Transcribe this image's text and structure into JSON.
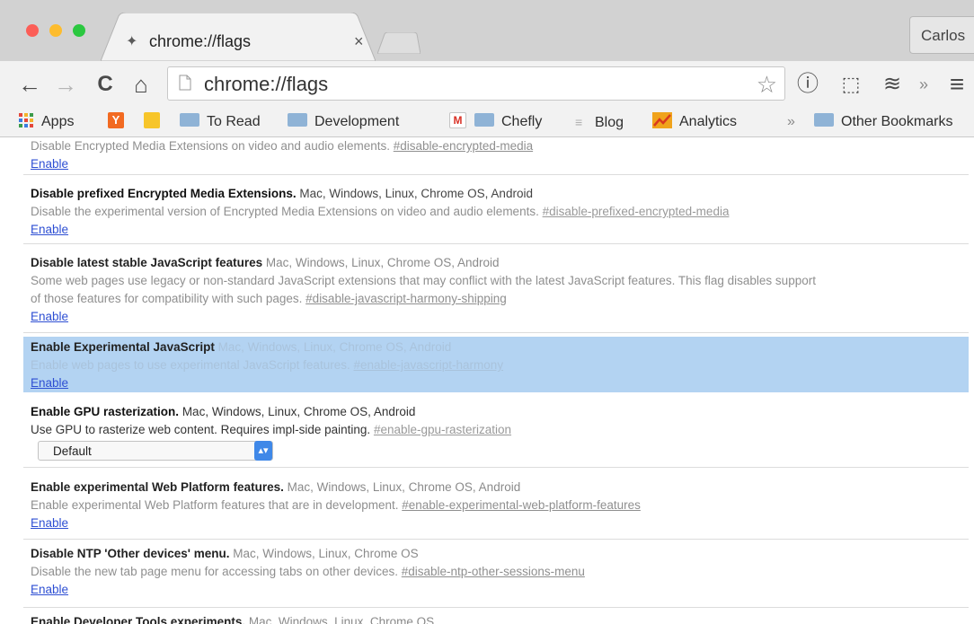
{
  "tab": {
    "favicon": "flags-icon",
    "title": "chrome://flags",
    "close": "×"
  },
  "profile": "Carlos",
  "toolbar": {
    "back": "←",
    "forward": "→",
    "reload": "C",
    "home": "⌂",
    "url": "chrome://flags",
    "star": "☆",
    "extension_1": "ⓘ",
    "extension_2": "⬚",
    "extension_3": "≋",
    "overflow": "»",
    "menu": "≡"
  },
  "bookmarks": [
    {
      "label": "Apps",
      "icon": "apps-grid-icon"
    },
    {
      "label": "Y",
      "icon": "y-icon"
    },
    {
      "label": "",
      "icon": "keep-icon"
    },
    {
      "label": "To Read",
      "icon": "folder-icon"
    },
    {
      "label": "Development",
      "icon": "folder-icon"
    },
    {
      "label": "M",
      "icon": "gmail-icon"
    },
    {
      "label": "Chefly",
      "icon": "folder-icon"
    },
    {
      "label": "Blog",
      "icon": "doc-icon"
    },
    {
      "label": "Analytics",
      "icon": "analytics-icon"
    },
    {
      "label": "»",
      "icon": "chevron-icon"
    },
    {
      "label": "Other Bookmarks",
      "icon": "folder-icon"
    }
  ],
  "flags": [
    {
      "name": "",
      "platforms": "",
      "description": "Disable Encrypted Media Extensions on video and audio elements.",
      "description2": "",
      "anchor": "#disable-encrypted-media",
      "action": "Enable"
    },
    {
      "name": "Disable prefixed Encrypted Media Extensions.",
      "platforms": "Mac, Windows, Linux, Chrome OS, Android",
      "description": "Disable the experimental version of Encrypted Media Extensions on video and audio elements.",
      "description2": "",
      "anchor": "#disable-prefixed-encrypted-media",
      "action": "Enable"
    },
    {
      "name": "Disable latest stable JavaScript features",
      "platforms": "Mac, Windows, Linux, Chrome OS, Android",
      "description": "Some web pages use legacy or non-standard JavaScript extensions that may conflict with the latest JavaScript features. This flag disables support",
      "description2": "of those features for compatibility with such pages.",
      "anchor": "#disable-javascript-harmony-shipping",
      "action": "Enable"
    },
    {
      "name": "Enable Experimental JavaScript",
      "platforms": "Mac, Windows, Linux, Chrome OS, Android",
      "description": "Enable web pages to use experimental JavaScript features.",
      "description2": "",
      "anchor": "#enable-javascript-harmony",
      "action": "Enable"
    },
    {
      "name": "Enable GPU rasterization.",
      "platforms": "Mac, Windows, Linux, Chrome OS, Android",
      "description": "Use GPU to rasterize web content. Requires impl-side painting.",
      "description2": "",
      "anchor": "#enable-gpu-rasterization",
      "select_value": "Default"
    },
    {
      "name": "Enable experimental Web Platform features.",
      "platforms": "Mac, Windows, Linux, Chrome OS, Android",
      "description": "Enable experimental Web Platform features that are in development.",
      "description2": "",
      "anchor": "#enable-experimental-web-platform-features",
      "action": "Enable"
    },
    {
      "name": "Disable NTP 'Other devices' menu.",
      "platforms": "Mac, Windows, Linux, Chrome OS",
      "description": "Disable the new tab page menu for accessing tabs on other devices.",
      "description2": "",
      "anchor": "#disable-ntp-other-sessions-menu",
      "action": "Enable"
    },
    {
      "name": "Enable Developer Tools experiments.",
      "platforms": "Mac, Windows, Linux, Chrome OS",
      "description": "",
      "description2": "",
      "anchor": "",
      "action": ""
    }
  ],
  "colors": {
    "highlight": "#b3d3f2",
    "link": "#2e4fd3",
    "select_arrow": "#3f88e8",
    "folder": "#8fb3d6"
  }
}
